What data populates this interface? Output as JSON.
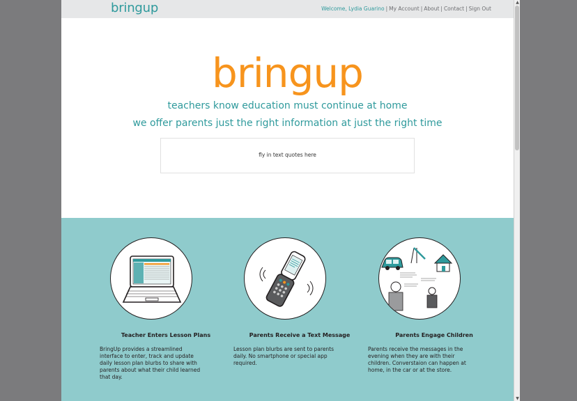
{
  "header": {
    "logo": "bringup",
    "welcome": "Welcome, Lydia Guarino",
    "nav": [
      "My Account",
      "About",
      "Contact",
      "Sign Out"
    ]
  },
  "hero": {
    "logo": "bringup",
    "tagline1": "teachers know education must continue at home",
    "tagline2": "we offer parents just the right information at just the right time",
    "quote_placeholder": "fly in text quotes here"
  },
  "features": [
    {
      "icon": "laptop-icon",
      "title": "Teacher Enters Lesson Plans",
      "text": "BringUp provides a streamlined interface to enter, track and update daily lesson plan blurbs to share with parents about what their child learned that day."
    },
    {
      "icon": "flip-phone-icon",
      "title": "Parents Receive a Text Message",
      "text": "Lesson plan blurbs are sent to parents daily. No smartphone or special app required."
    },
    {
      "icon": "family-scene-icon",
      "title": "Parents Engage Children",
      "text": "Parents receive the messages in the evening when they are with their children. Converstaion can happen at home, in the car or at the store."
    }
  ],
  "colors": {
    "brand_teal": "#2f9a9c",
    "brand_orange": "#f7941d",
    "features_bg": "#8fcbcc",
    "topbar_bg": "#e6e7e8",
    "outer_bg": "#7b7b7d"
  }
}
